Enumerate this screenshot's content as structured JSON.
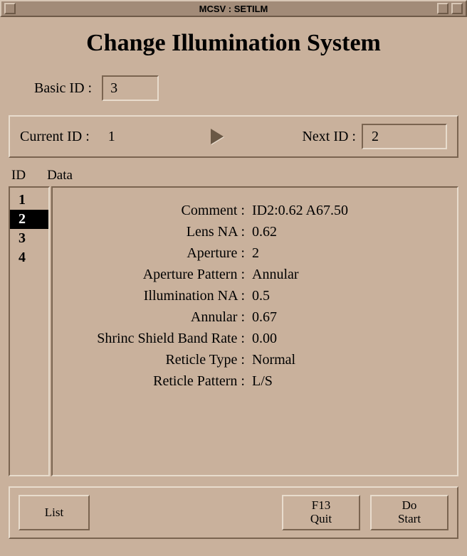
{
  "window": {
    "title": "MCSV : SETILM"
  },
  "header": {
    "title": "Change Illumination System"
  },
  "basic": {
    "label": "Basic ID :",
    "value": "3"
  },
  "current": {
    "label": "Current ID :",
    "value": "1"
  },
  "next": {
    "label": "Next ID :",
    "value": "2"
  },
  "columns": {
    "id": "ID",
    "data": "Data"
  },
  "ids": {
    "items": [
      "1",
      "2",
      "3",
      "4"
    ],
    "selected_index": 1
  },
  "details": {
    "rows": [
      {
        "label": "Comment :",
        "value": "ID2:0.62 A67.50"
      },
      {
        "label": "Lens NA :",
        "value": "0.62"
      },
      {
        "label": "Aperture :",
        "value": "2"
      },
      {
        "label": "Aperture Pattern :",
        "value": "Annular"
      },
      {
        "label": "Illumination NA :",
        "value": "0.5"
      },
      {
        "label": "Annular :",
        "value": "0.67"
      },
      {
        "label": "Shrinc Shield Band Rate :",
        "value": "0.00"
      },
      {
        "label": "Reticle Type :",
        "value": "Normal"
      },
      {
        "label": "Reticle Pattern :",
        "value": "L/S"
      }
    ]
  },
  "buttons": {
    "list": "List",
    "quit_l1": "F13",
    "quit_l2": "Quit",
    "do_l1": "Do",
    "do_l2": "Start"
  }
}
